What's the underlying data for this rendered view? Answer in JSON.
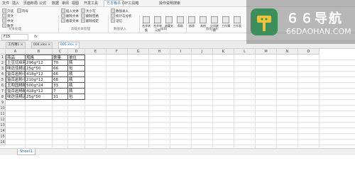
{
  "menu_tabs": [
    "文件",
    "插入",
    "页面布局",
    "公式",
    "数据",
    "审阅",
    "视图",
    "开发工具",
    "方方格子",
    "DIY工具箱",
    "操作说明搜索"
  ],
  "active_menu": "方方格子",
  "ribbon": {
    "left_items": [
      "只读",
      "英文",
      "中文",
      "数字",
      "符号",
      "插入文本",
      "删除文本",
      "截取文本",
      "大小写",
      "删除空格",
      "删除指定",
      "数值录入",
      "统计与分析",
      "记忆",
      "凭证",
      "凭证",
      "总计",
      "删除",
      "删除表格"
    ],
    "big_buttons": [
      "合并转换",
      "合并单元格",
      "收藏夹",
      "帮助",
      "修改",
      "其他",
      "分列转换",
      "工作簿",
      "工作表"
    ],
    "group_labels": [
      "文本处理",
      "高级文本处理",
      "数值录入",
      "编辑",
      "数据分析"
    ]
  },
  "formula_bar": {
    "name_box": "F15",
    "fx": "fx"
  },
  "workbook_tabs": [
    {
      "label": "工作簿1",
      "active": false
    },
    {
      "label": "004.xlsx",
      "active": false
    },
    {
      "label": "005.xlsx",
      "active": true
    }
  ],
  "columns": [
    "A",
    "B",
    "C",
    "D",
    "E",
    "F",
    "G",
    "H",
    "I",
    "J",
    "K",
    "L",
    "M",
    "N",
    "O"
  ],
  "rows": [
    "1",
    "2",
    "3",
    "4",
    "5",
    "6",
    "7",
    "8",
    "9",
    "10",
    "11",
    "12",
    "13",
    "14",
    "15",
    "16"
  ],
  "table": {
    "headers": [
      "商品",
      "规格",
      "数量",
      "单位"
    ],
    "rows": [
      [
        "土豆切丝利器机",
        "296g*12",
        "70",
        "瓶"
      ],
      [
        "味达佳精选炖汤",
        "25g*50",
        "66",
        "包"
      ],
      [
        "益百岩粉小米椒",
        "418g*12",
        "66",
        "瓶"
      ],
      [
        "益百岩粉小米椒",
        "210g*12",
        "68",
        "瓶"
      ],
      [
        "玉和园精制钢钢罐",
        "500g*24",
        "33",
        "瓶"
      ],
      [
        "益百岩精制钢钢罐",
        "418g*12",
        "7",
        "瓶"
      ],
      [
        "味达佳精选八角",
        "25g*50",
        "31",
        "包"
      ]
    ]
  },
  "sheets": [
    "Sheet1"
  ],
  "watermark": {
    "title": "６６导航",
    "subtitle": "66DAOHAN.COM"
  }
}
